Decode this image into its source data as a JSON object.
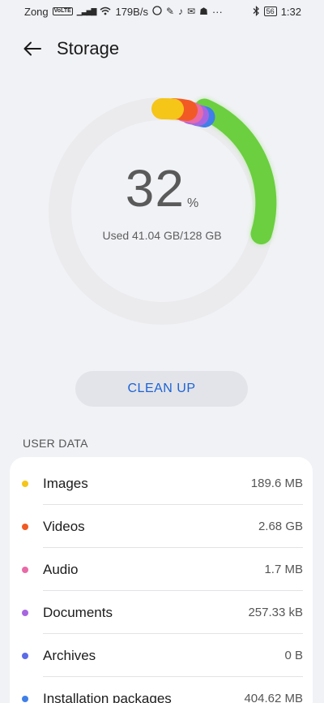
{
  "status_bar": {
    "carrier": "Zong",
    "volte": "VoLTE",
    "net_speed": "179B/s",
    "more": "···",
    "battery": "56",
    "time": "1:32"
  },
  "header": {
    "title": "Storage"
  },
  "gauge": {
    "percent": "32",
    "percent_unit": "%",
    "used_text": "Used 41.04 GB/128 GB"
  },
  "cleanup_label": "CLEAN UP",
  "section_title": "USER DATA",
  "items": [
    {
      "label": "Images",
      "value": "189.6 MB",
      "color": "#f5c518"
    },
    {
      "label": "Videos",
      "value": "2.68 GB",
      "color": "#f15a24"
    },
    {
      "label": "Audio",
      "value": "1.7 MB",
      "color": "#e96aa6"
    },
    {
      "label": "Documents",
      "value": "257.33 kB",
      "color": "#a766e0"
    },
    {
      "label": "Archives",
      "value": "0 B",
      "color": "#5c6be8"
    },
    {
      "label": "Installation packages",
      "value": "404.62 MB",
      "color": "#3f7fe8"
    }
  ],
  "colors": {
    "accent": "#1c63d6",
    "track": "#ebebee",
    "green": "#6bcf3f"
  }
}
